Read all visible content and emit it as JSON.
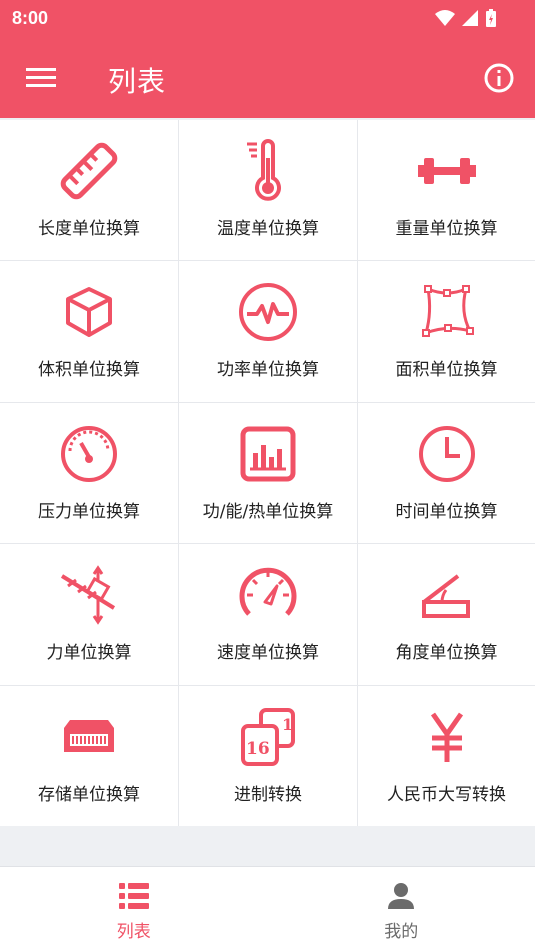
{
  "status": {
    "time": "8:00"
  },
  "appbar": {
    "title": "列表",
    "menu_icon": "menu-icon",
    "info_icon": "info-icon"
  },
  "accent": "#f05266",
  "grid": [
    {
      "label": "长度单位换算",
      "icon": "ruler-icon"
    },
    {
      "label": "温度单位换算",
      "icon": "thermometer-icon"
    },
    {
      "label": "重量单位换算",
      "icon": "dumbbell-icon"
    },
    {
      "label": "体积单位换算",
      "icon": "cube-icon"
    },
    {
      "label": "功率单位换算",
      "icon": "power-pulse-icon"
    },
    {
      "label": "面积单位换算",
      "icon": "area-icon"
    },
    {
      "label": "压力单位换算",
      "icon": "gauge-icon"
    },
    {
      "label": "功/能/热单位换算",
      "icon": "bar-chart-icon"
    },
    {
      "label": "时间单位换算",
      "icon": "clock-icon"
    },
    {
      "label": "力单位换算",
      "icon": "force-icon"
    },
    {
      "label": "速度单位换算",
      "icon": "speedometer-icon"
    },
    {
      "label": "角度单位换算",
      "icon": "angle-icon"
    },
    {
      "label": "存储单位换算",
      "icon": "storage-icon"
    },
    {
      "label": "进制转换",
      "icon": "base-number-icon"
    },
    {
      "label": "人民币大写转换",
      "icon": "yuan-icon"
    }
  ],
  "bottom_nav": [
    {
      "label": "列表",
      "icon": "list-icon",
      "active": true
    },
    {
      "label": "我的",
      "icon": "person-icon",
      "active": false
    }
  ]
}
